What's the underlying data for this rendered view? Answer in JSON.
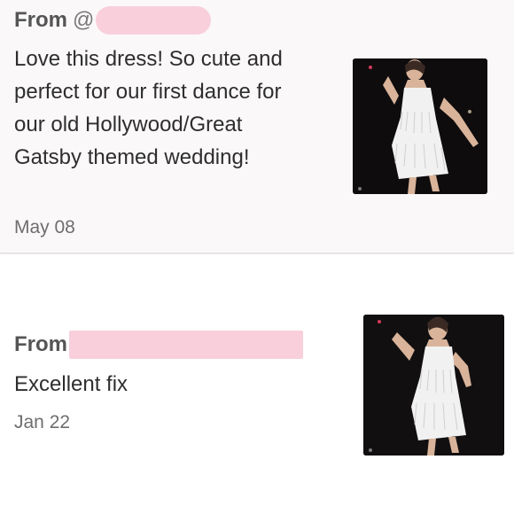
{
  "reviews": [
    {
      "from_label": "From",
      "at_sign": "@",
      "message": "Love this dress! So cute and perfect for our first dance for our old Hollywood/Great Gatsby themed wedding!",
      "date": "May 08",
      "image_icon": "fringe-dress-photo"
    },
    {
      "from_label": "From",
      "message": "Excellent fix",
      "date": "Jan 22",
      "image_icon": "fringe-dress-photo"
    }
  ],
  "colors": {
    "redaction": "#f9cfdc",
    "card_background": "#fbf8f9",
    "text": "#2e2e2e",
    "muted": "#6e6e6e"
  }
}
